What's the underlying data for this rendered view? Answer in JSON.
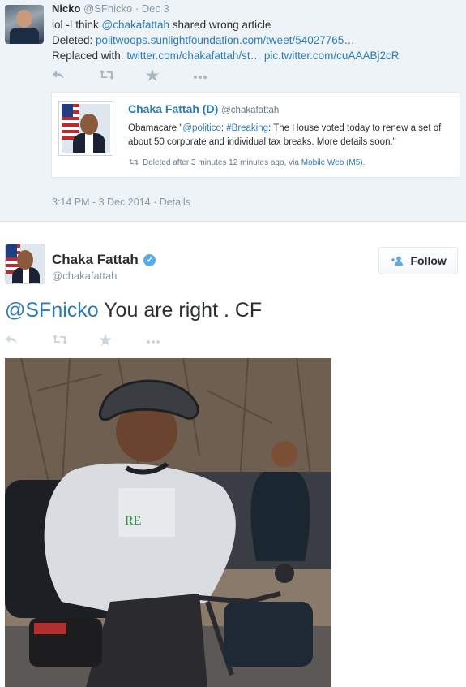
{
  "reply": {
    "name": "Nicko",
    "handle": "@SFnicko",
    "sep": "·",
    "date": "Dec 3",
    "line1_pre": "lol -I think ",
    "line1_mention": "@chakafattah",
    "line1_post": " shared wrong article",
    "line2_label": "Deleted: ",
    "line2_link": "politwoops.sunlightfoundation.com/tweet/54027765…",
    "line3_label": "Replaced with: ",
    "line3_link1": "twitter.com/chakafattah/st…",
    "line3_link2": "pic.twitter.com/cuAAABj2cR",
    "timestamp": "3:14 PM - 3 Dec 2014 · Details"
  },
  "quote": {
    "name": "Chaka Fattah (D)",
    "handle": "@chakafattah",
    "text_pre": "Obamacare \"",
    "text_mention": "@politico",
    "text_mid": ": ",
    "text_hashtag": "#Breaking",
    "text_post": ": The House voted today to renew a set of about 50 corporate and individual tax breaks. More details soon.\"",
    "meta_pre": "Deleted after 3 minutes ",
    "meta_underline": "12 minutes",
    "meta_mid": " ago, via ",
    "meta_link": "Mobile Web (M5)",
    "meta_end": "."
  },
  "main": {
    "name": "Chaka Fattah",
    "handle": "@chakafattah",
    "follow_label": "Follow",
    "text_mention": "@SFnicko",
    "text_body": " You are right . CF"
  },
  "icons": {
    "reply": "reply-icon",
    "retweet": "retweet-icon",
    "favorite": "star-icon",
    "more": "more-icon",
    "verified": "verified-badge-icon",
    "follow": "add-person-icon",
    "via": "retweet-small-icon"
  },
  "colors": {
    "link": "#2b7bb9",
    "muted": "#8899a6",
    "top_bg": "#eef3f8",
    "verified": "#55acee"
  }
}
